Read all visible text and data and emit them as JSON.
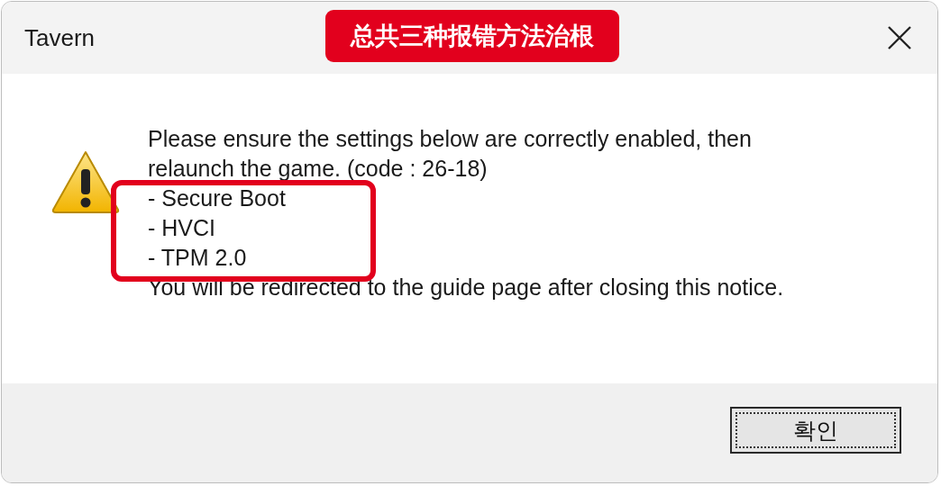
{
  "window": {
    "title": "Tavern"
  },
  "annotation": {
    "text": "总共三种报错方法治根"
  },
  "message": {
    "lines": [
      {
        "kind": "text",
        "text": "Please ensure the settings below are correctly enabled, then relaunch the game. (code : 26-18)"
      },
      {
        "kind": "item",
        "text": "- Secure Boot"
      },
      {
        "kind": "item",
        "text": "- HVCI"
      },
      {
        "kind": "item",
        "text": "- TPM 2.0"
      },
      {
        "kind": "text",
        "text": "You will be redirected to the guide page after closing this notice."
      }
    ]
  },
  "buttons": [
    {
      "label": "확인",
      "focused": true
    }
  ]
}
